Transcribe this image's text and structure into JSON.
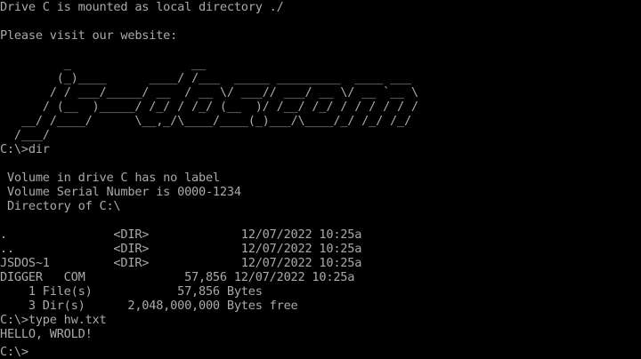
{
  "terminal": {
    "mount_message": "Drive C is mounted as local directory ./",
    "website_prompt": "Please visit our website:",
    "ascii_logo": [
      "         _                 __",
      "        (_)____      ____/ /___  _____ _________  ____ ___",
      "       / / ___/_____/ __  / __ \\/ ___// ___/ __ \\/ __ `__ \\",
      "      / (__  )_____/ /_/ / /_/ (__  )/ /__/ /_/ / / / / / /",
      "   __/ /____/      \\__,_/\\____/____(_)___/\\____/_/ /_/ /_/",
      "  /___/"
    ],
    "command_1": "C:\\>dir",
    "dir_header": [
      " Volume in drive C has no label",
      " Volume Serial Number is 0000-1234",
      " Directory of C:\\"
    ],
    "dir_entries": [
      ".               <DIR>             12/07/2022 10:25a",
      "..              <DIR>             12/07/2022 10:25a",
      "JSDOS~1         <DIR>             12/07/2022 10:25a",
      "DIGGER   COM              57,856 12/07/2022 10:25a"
    ],
    "summary": [
      "    1 File(s)            57,856 Bytes",
      "    3 Dir(s)      2,048,000,000 Bytes free"
    ],
    "command_2": "C:\\>type hw.txt",
    "file_output": "HELLO, WROLD!",
    "prompt": "C:\\>"
  }
}
